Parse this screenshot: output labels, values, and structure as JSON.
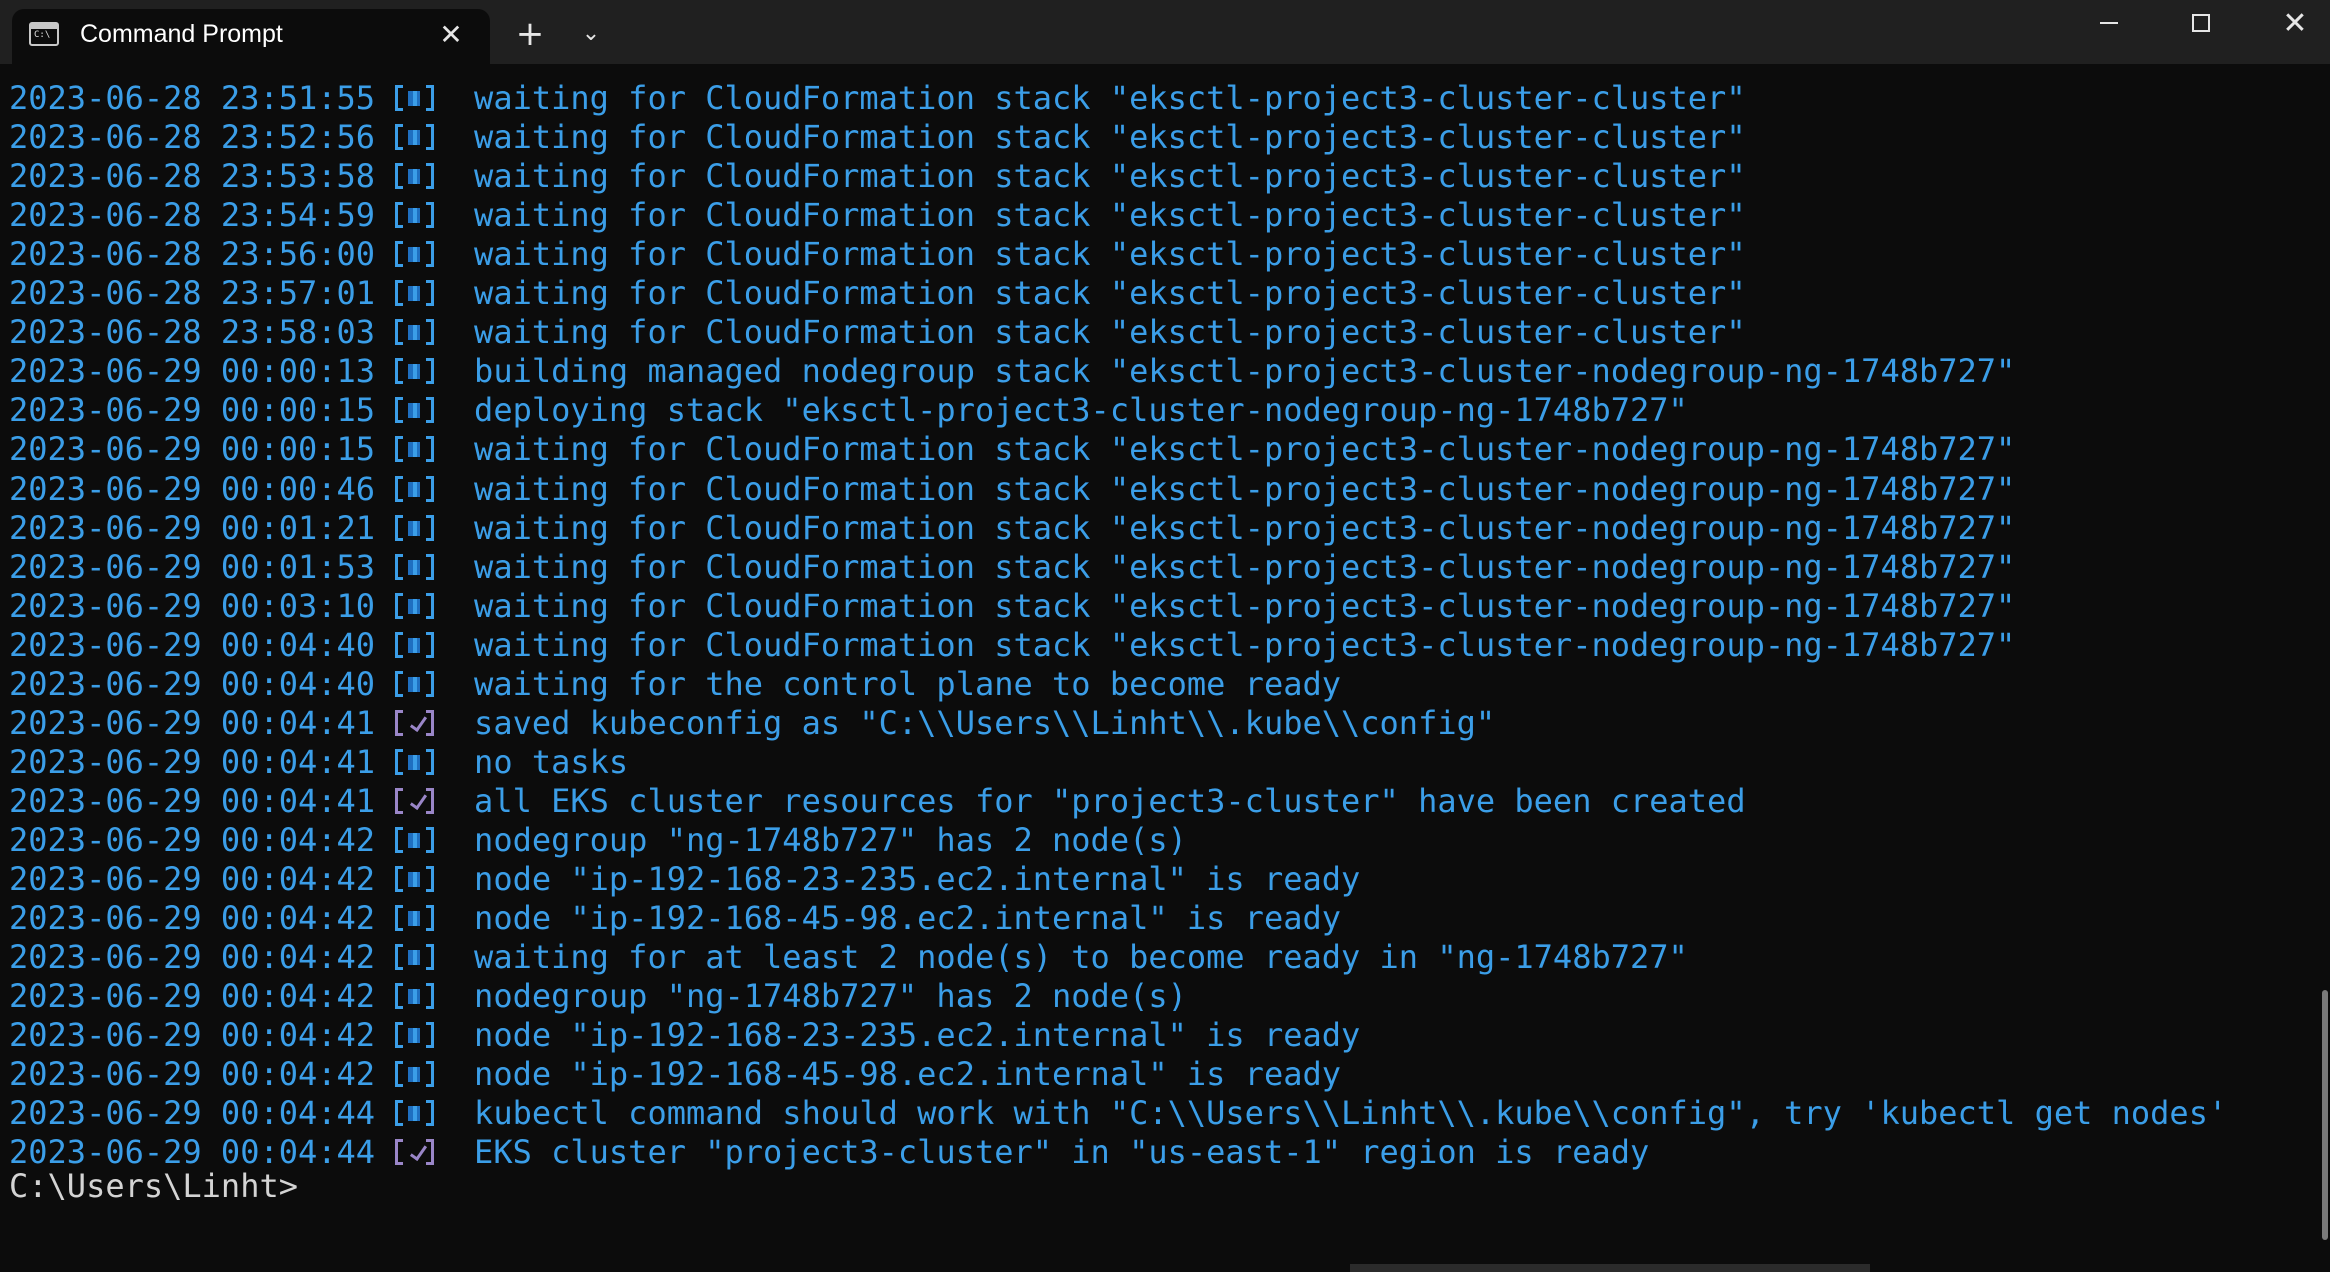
{
  "window": {
    "tab_title": "Command Prompt",
    "tab_icon": "terminal-icon",
    "close_tab_glyph": "✕",
    "new_tab_glyph": "+",
    "dropdown_glyph": "⌄",
    "close_window_glyph": "✕"
  },
  "colors": {
    "background": "#0c0c0c",
    "titlebar": "#202020",
    "log_text": "#3b9ee8",
    "success_icon": "#9a86c8",
    "prompt_text": "#d4d4d4"
  },
  "log_lines": [
    {
      "timestamp": "2023-06-28 23:51:55",
      "status": "info",
      "message": "waiting for CloudFormation stack \"eksctl-project3-cluster-cluster\""
    },
    {
      "timestamp": "2023-06-28 23:52:56",
      "status": "info",
      "message": "waiting for CloudFormation stack \"eksctl-project3-cluster-cluster\""
    },
    {
      "timestamp": "2023-06-28 23:53:58",
      "status": "info",
      "message": "waiting for CloudFormation stack \"eksctl-project3-cluster-cluster\""
    },
    {
      "timestamp": "2023-06-28 23:54:59",
      "status": "info",
      "message": "waiting for CloudFormation stack \"eksctl-project3-cluster-cluster\""
    },
    {
      "timestamp": "2023-06-28 23:56:00",
      "status": "info",
      "message": "waiting for CloudFormation stack \"eksctl-project3-cluster-cluster\""
    },
    {
      "timestamp": "2023-06-28 23:57:01",
      "status": "info",
      "message": "waiting for CloudFormation stack \"eksctl-project3-cluster-cluster\""
    },
    {
      "timestamp": "2023-06-28 23:58:03",
      "status": "info",
      "message": "waiting for CloudFormation stack \"eksctl-project3-cluster-cluster\""
    },
    {
      "timestamp": "2023-06-29 00:00:13",
      "status": "info",
      "message": "building managed nodegroup stack \"eksctl-project3-cluster-nodegroup-ng-1748b727\""
    },
    {
      "timestamp": "2023-06-29 00:00:15",
      "status": "info",
      "message": "deploying stack \"eksctl-project3-cluster-nodegroup-ng-1748b727\""
    },
    {
      "timestamp": "2023-06-29 00:00:15",
      "status": "info",
      "message": "waiting for CloudFormation stack \"eksctl-project3-cluster-nodegroup-ng-1748b727\""
    },
    {
      "timestamp": "2023-06-29 00:00:46",
      "status": "info",
      "message": "waiting for CloudFormation stack \"eksctl-project3-cluster-nodegroup-ng-1748b727\""
    },
    {
      "timestamp": "2023-06-29 00:01:21",
      "status": "info",
      "message": "waiting for CloudFormation stack \"eksctl-project3-cluster-nodegroup-ng-1748b727\""
    },
    {
      "timestamp": "2023-06-29 00:01:53",
      "status": "info",
      "message": "waiting for CloudFormation stack \"eksctl-project3-cluster-nodegroup-ng-1748b727\""
    },
    {
      "timestamp": "2023-06-29 00:03:10",
      "status": "info",
      "message": "waiting for CloudFormation stack \"eksctl-project3-cluster-nodegroup-ng-1748b727\""
    },
    {
      "timestamp": "2023-06-29 00:04:40",
      "status": "info",
      "message": "waiting for CloudFormation stack \"eksctl-project3-cluster-nodegroup-ng-1748b727\""
    },
    {
      "timestamp": "2023-06-29 00:04:40",
      "status": "info",
      "message": "waiting for the control plane to become ready"
    },
    {
      "timestamp": "2023-06-29 00:04:41",
      "status": "ok",
      "message": "saved kubeconfig as \"C:\\\\Users\\\\Linht\\\\.kube\\\\config\""
    },
    {
      "timestamp": "2023-06-29 00:04:41",
      "status": "info",
      "message": "no tasks"
    },
    {
      "timestamp": "2023-06-29 00:04:41",
      "status": "ok",
      "message": "all EKS cluster resources for \"project3-cluster\" have been created"
    },
    {
      "timestamp": "2023-06-29 00:04:42",
      "status": "info",
      "message": "nodegroup \"ng-1748b727\" has 2 node(s)"
    },
    {
      "timestamp": "2023-06-29 00:04:42",
      "status": "info",
      "message": "node \"ip-192-168-23-235.ec2.internal\" is ready"
    },
    {
      "timestamp": "2023-06-29 00:04:42",
      "status": "info",
      "message": "node \"ip-192-168-45-98.ec2.internal\" is ready"
    },
    {
      "timestamp": "2023-06-29 00:04:42",
      "status": "info",
      "message": "waiting for at least 2 node(s) to become ready in \"ng-1748b727\""
    },
    {
      "timestamp": "2023-06-29 00:04:42",
      "status": "info",
      "message": "nodegroup \"ng-1748b727\" has 2 node(s)"
    },
    {
      "timestamp": "2023-06-29 00:04:42",
      "status": "info",
      "message": "node \"ip-192-168-23-235.ec2.internal\" is ready"
    },
    {
      "timestamp": "2023-06-29 00:04:42",
      "status": "info",
      "message": "node \"ip-192-168-45-98.ec2.internal\" is ready"
    },
    {
      "timestamp": "2023-06-29 00:04:44",
      "status": "info",
      "message": "kubectl command should work with \"C:\\\\Users\\\\Linht\\\\.kube\\\\config\", try 'kubectl get nodes'"
    },
    {
      "timestamp": "2023-06-29 00:04:44",
      "status": "ok",
      "message": "EKS cluster \"project3-cluster\" in \"us-east-1\" region is ready"
    }
  ],
  "prompt": "C:\\Users\\Linht>"
}
